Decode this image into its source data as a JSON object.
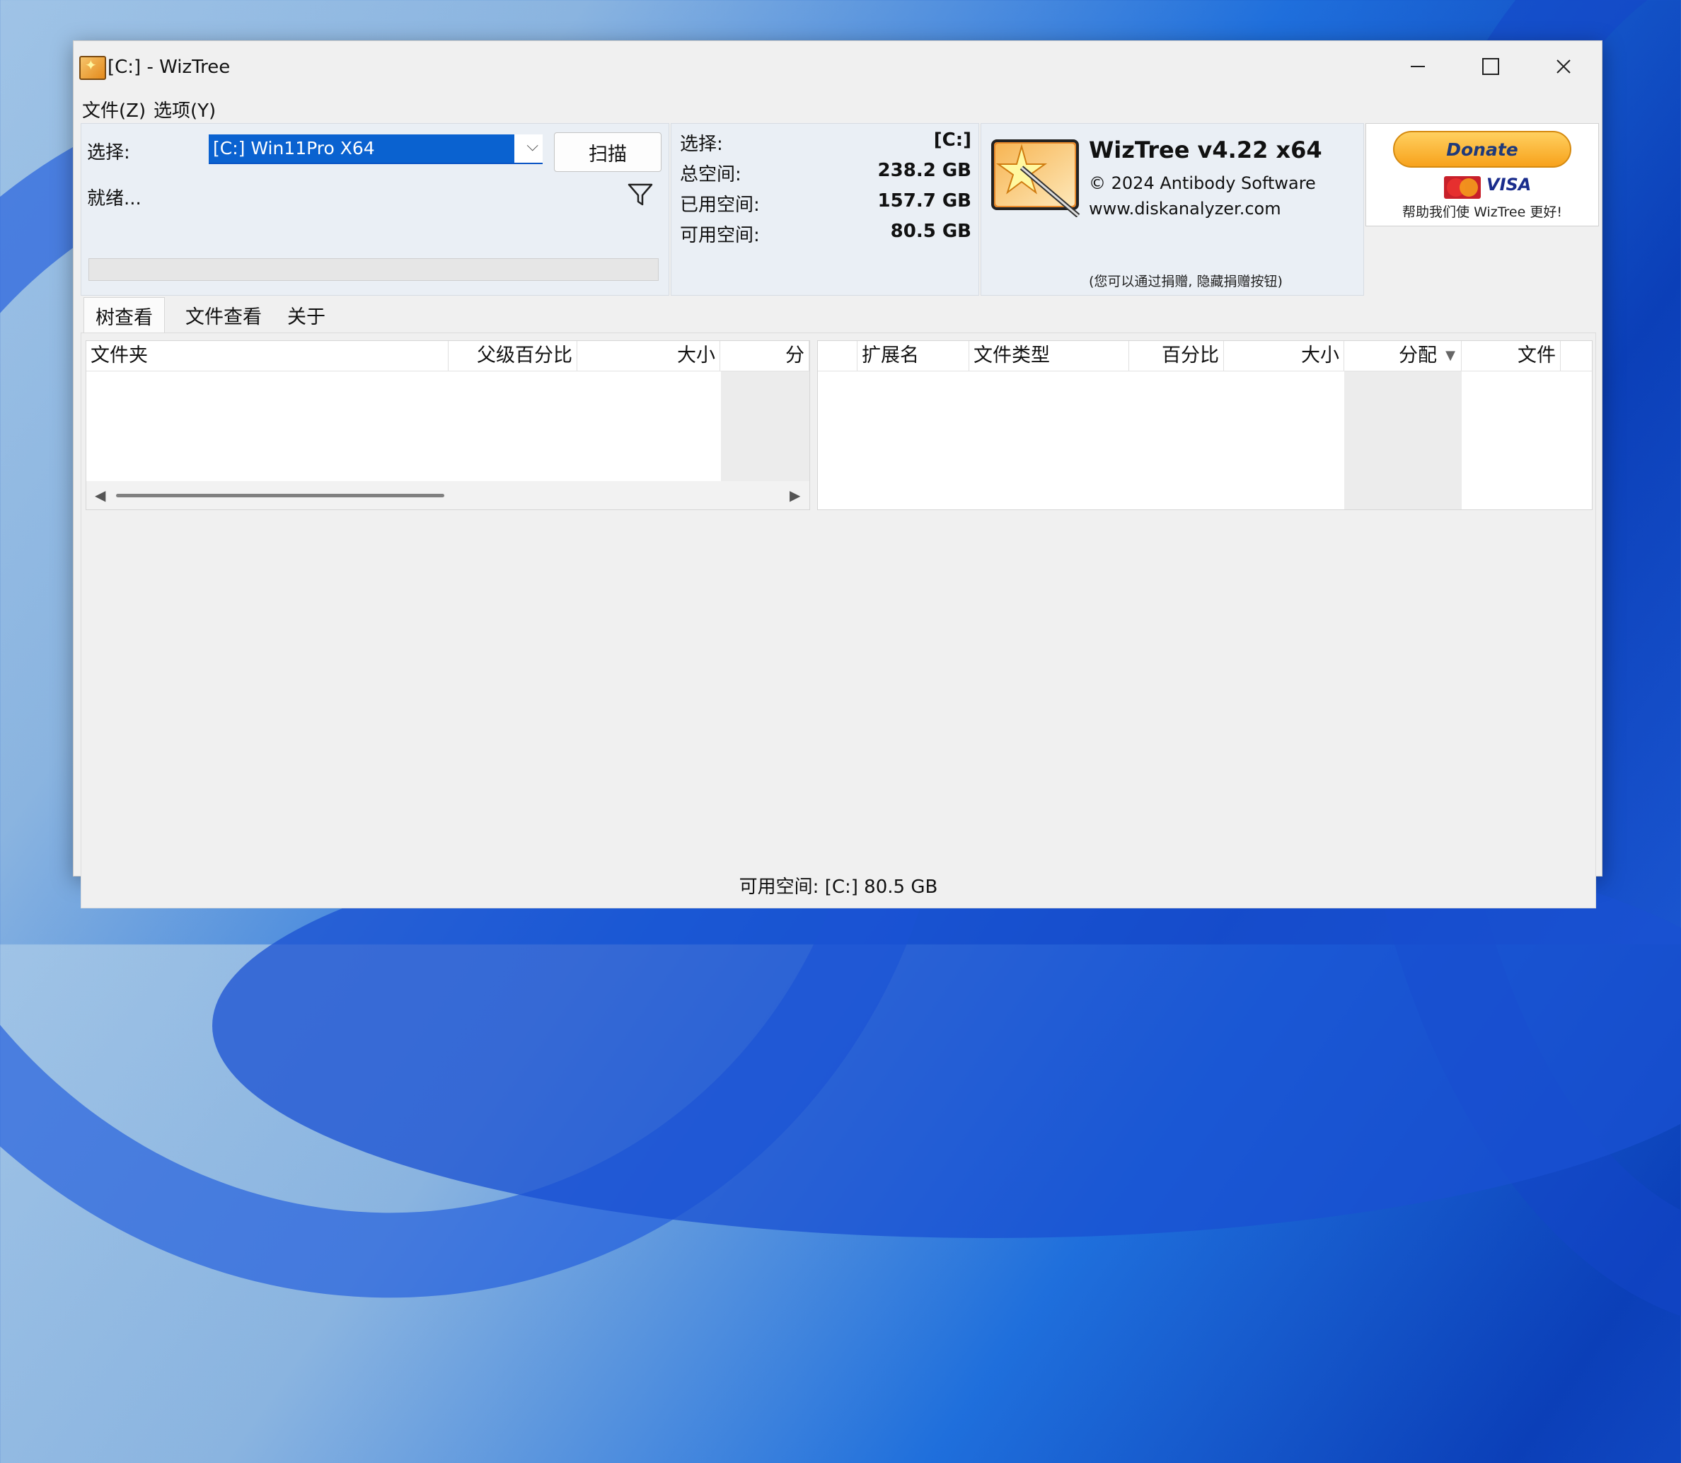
{
  "window": {
    "title": "[C:]  - WizTree"
  },
  "menu": [
    "文件(Z)",
    "选项(Y)"
  ],
  "selection": {
    "label": "选择:",
    "drive": "[C:] Win11Pro X64",
    "scan_label": "扫描",
    "status": "就绪..."
  },
  "drive_info": {
    "select_label": "选择:",
    "select_value": "[C:]",
    "total_label": "总空间:",
    "total_value": "238.2 GB",
    "used_label": "已用空间:",
    "used_value": "157.7 GB",
    "free_label": "可用空间:",
    "free_value": "80.5 GB"
  },
  "about": {
    "title": "WizTree v4.22 x64",
    "copyright": "© 2024 Antibody Software",
    "website": "www.diskanalyzer.com",
    "hide_hint": "(您可以通过捐赠, 隐藏捐赠按钮)"
  },
  "donate": {
    "button_label": "Donate",
    "visa": "VISA",
    "text": "帮助我们使 WizTree 更好!"
  },
  "tabs": [
    "树查看",
    "文件查看",
    "关于"
  ],
  "tree_columns": [
    "文件夹",
    "父级百分比",
    "大小",
    "分"
  ],
  "file_columns": [
    "扩展名",
    "文件类型",
    "百分比",
    "大小",
    "分配",
    "文件"
  ],
  "status_bar": "可用空间: [C:] 80.5 GB",
  "colors": {
    "accent": "#0a62d0",
    "panel": "#eaeff5",
    "window": "#f0f0f0"
  }
}
